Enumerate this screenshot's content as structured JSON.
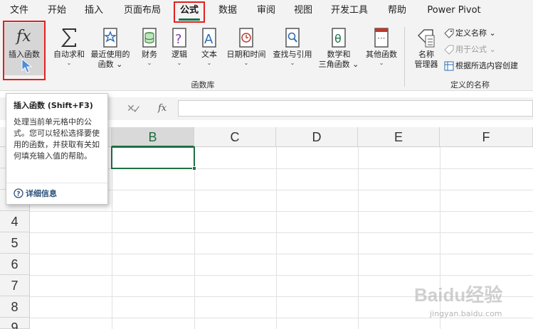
{
  "tabs": [
    "文件",
    "开始",
    "插入",
    "页面布局",
    "公式",
    "数据",
    "审阅",
    "视图",
    "开发工具",
    "帮助",
    "Power Pivot"
  ],
  "active_tab": "公式",
  "ribbon": {
    "insert_function": "插入函数",
    "autosum": "自动求和",
    "recent_line1": "最近使用的",
    "recent_line2": "函数",
    "financial": "财务",
    "logical": "逻辑",
    "text": "文本",
    "datetime": "日期和时间",
    "lookup": "查找与引用",
    "math_line1": "数学和",
    "math_line2": "三角函数",
    "other": "其他函数",
    "group_library": "函数库",
    "name_mgr_line1": "名称",
    "name_mgr_line2": "管理器",
    "define_name": "定义名称",
    "use_in_formula": "用于公式",
    "create_from_selection": "根据所选内容创建",
    "group_names": "定义的名称"
  },
  "formula_bar": {
    "cancel_symbol": "✕",
    "enter_symbol": "✓",
    "fx": "fx",
    "value": ""
  },
  "grid": {
    "columns": [
      "B",
      "C",
      "D",
      "E",
      "F"
    ],
    "selected_column": "B",
    "rows": [
      "4",
      "5",
      "6",
      "7",
      "8",
      "9"
    ]
  },
  "tooltip": {
    "title": "插入函数 (Shift+F3)",
    "body": "处理当前单元格中的公式。您可以轻松选择要使用的函数，并获取有关如何填充输入值的帮助。",
    "link": "详细信息"
  },
  "watermark": {
    "text": "Baidu经验",
    "sub": "jingyan.baidu.com"
  },
  "colors": {
    "accent_green": "#1e7145",
    "highlight_red": "#e0201e",
    "ribbon_bg": "#f3f3f3"
  }
}
